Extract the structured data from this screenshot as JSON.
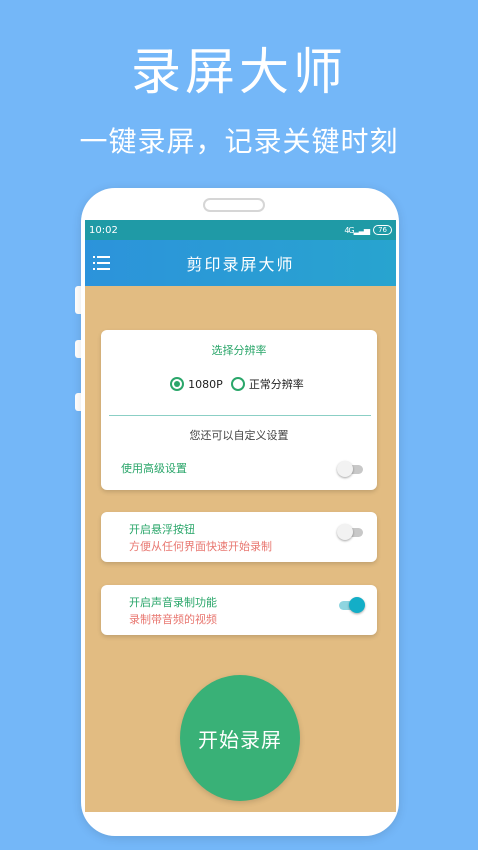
{
  "promo": {
    "title": "录屏大师",
    "subtitle": "一键录屏，记录关键时刻"
  },
  "status_bar": {
    "time": "10:02",
    "battery": "76",
    "signal": "4G"
  },
  "app_bar": {
    "title": "剪印录屏大师",
    "menu_icon": "menu-icon"
  },
  "resolution_card": {
    "title": "选择分辨率",
    "options": [
      {
        "label": "1080P",
        "selected": true
      },
      {
        "label": "正常分辨率",
        "selected": false
      }
    ],
    "custom_hint": "您还可以自定义设置",
    "advanced_label": "使用高级设置",
    "advanced_enabled": false
  },
  "floating_button_card": {
    "title": "开启悬浮按钮",
    "description": "方便从任何界面快速开始录制",
    "enabled": false
  },
  "audio_card": {
    "title": "开启声音录制功能",
    "description": "录制带音频的视频",
    "enabled": true
  },
  "start_button": {
    "label": "开始录屏"
  },
  "colors": {
    "background": "#74b7f8",
    "app_bar": "#2c93db",
    "content_bg": "#e2bc82",
    "accent_green": "#2aa66a",
    "description_red": "#e87770",
    "toggle_on": "#13aec7"
  }
}
